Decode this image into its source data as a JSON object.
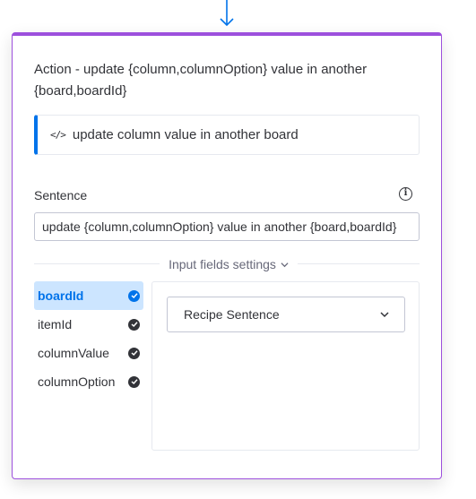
{
  "action": {
    "title": "Action - update {column,columnOption} value in another {board,boardId}",
    "code_label": "update column value in another board",
    "code_icon": "</>"
  },
  "sentence": {
    "label": "Sentence",
    "value": "update {column,columnOption} value in another {board,boardId}",
    "info_icon": "info-icon"
  },
  "settings": {
    "toggle_label": "Input fields settings"
  },
  "fields": [
    {
      "label": "boardId",
      "active": true
    },
    {
      "label": "itemId",
      "active": false
    },
    {
      "label": "columnValue",
      "active": false
    },
    {
      "label": "columnOption",
      "active": false
    }
  ],
  "panel": {
    "dropdown_value": "Recipe Sentence"
  },
  "colors": {
    "accent_purple": "#9d50dd",
    "accent_blue": "#0073ea",
    "active_bg": "#cce5ff"
  }
}
